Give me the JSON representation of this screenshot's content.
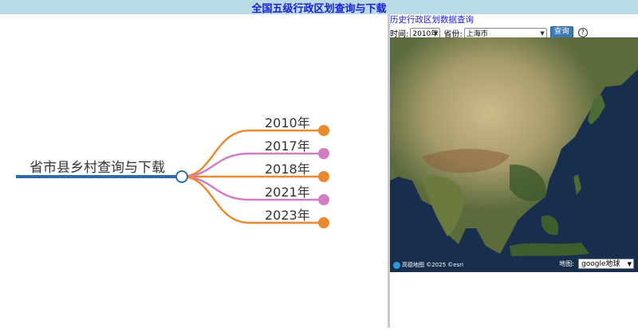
{
  "header": {
    "title": "全国五级行政区划查询与下载"
  },
  "mindmap": {
    "root_label": "省市县乡村查询与下载",
    "branches": [
      {
        "label": "2010年",
        "color": "#e98a2f"
      },
      {
        "label": "2017年",
        "color": "#d27cc4"
      },
      {
        "label": "2018年",
        "color": "#e98a2f"
      },
      {
        "label": "2021年",
        "color": "#d27cc4"
      },
      {
        "label": "2023年",
        "color": "#e98a2f"
      }
    ],
    "root_line_color": "#2f6aa8"
  },
  "panel": {
    "title": "历史行政区划数据查询",
    "time_label": "时间:",
    "time_value": "2010年",
    "province_label": "省份:",
    "province_value": "上海市",
    "query_button": "查询",
    "help_icon": "question-circle-icon"
  },
  "map": {
    "attribution": "高德地图 ©2025 ©esri",
    "type_label": "地图:",
    "type_value": "google地球"
  }
}
